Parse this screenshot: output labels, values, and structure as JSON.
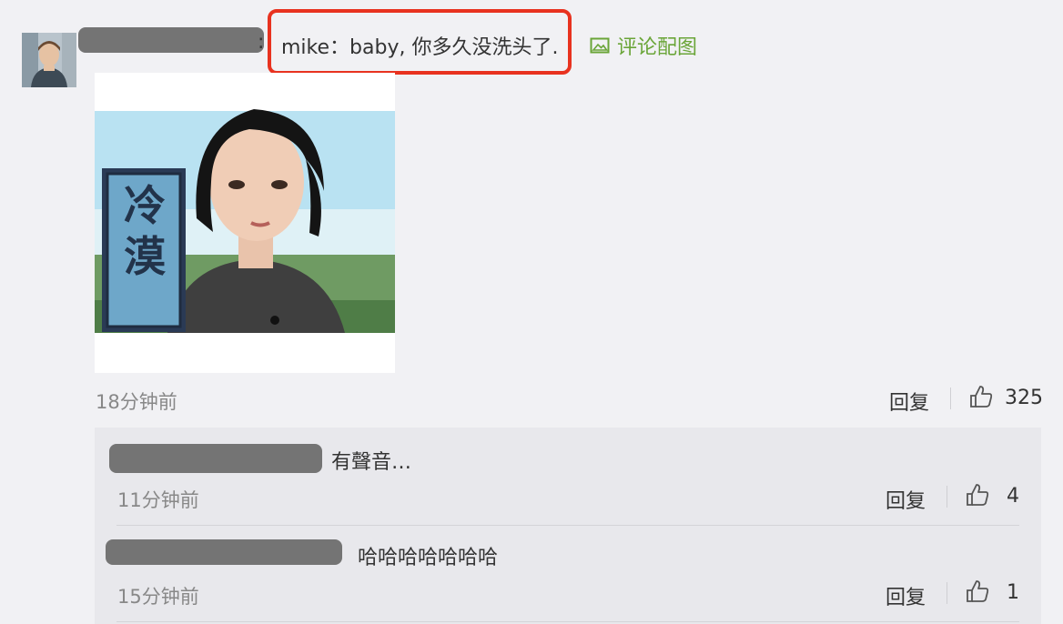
{
  "comment": {
    "text": "mike：baby, 你多久没洗头了.",
    "attach_label": "评论配图",
    "attach_icon": "image-icon",
    "time": "18分钟前",
    "reply_label": "回复",
    "like_icon": "thumbs-up-icon",
    "like_count": "325",
    "highlight_color": "#e8321f",
    "attach_color": "#6aa538",
    "picture": {
      "caption_chars": "冷漠"
    }
  },
  "replies": [
    {
      "text": "有聲音…",
      "time": "11分钟前",
      "reply_label": "回复",
      "like_count": "4"
    },
    {
      "text": "哈哈哈哈哈哈哈",
      "time": "15分钟前",
      "reply_label": "回复",
      "like_count": "1"
    }
  ]
}
